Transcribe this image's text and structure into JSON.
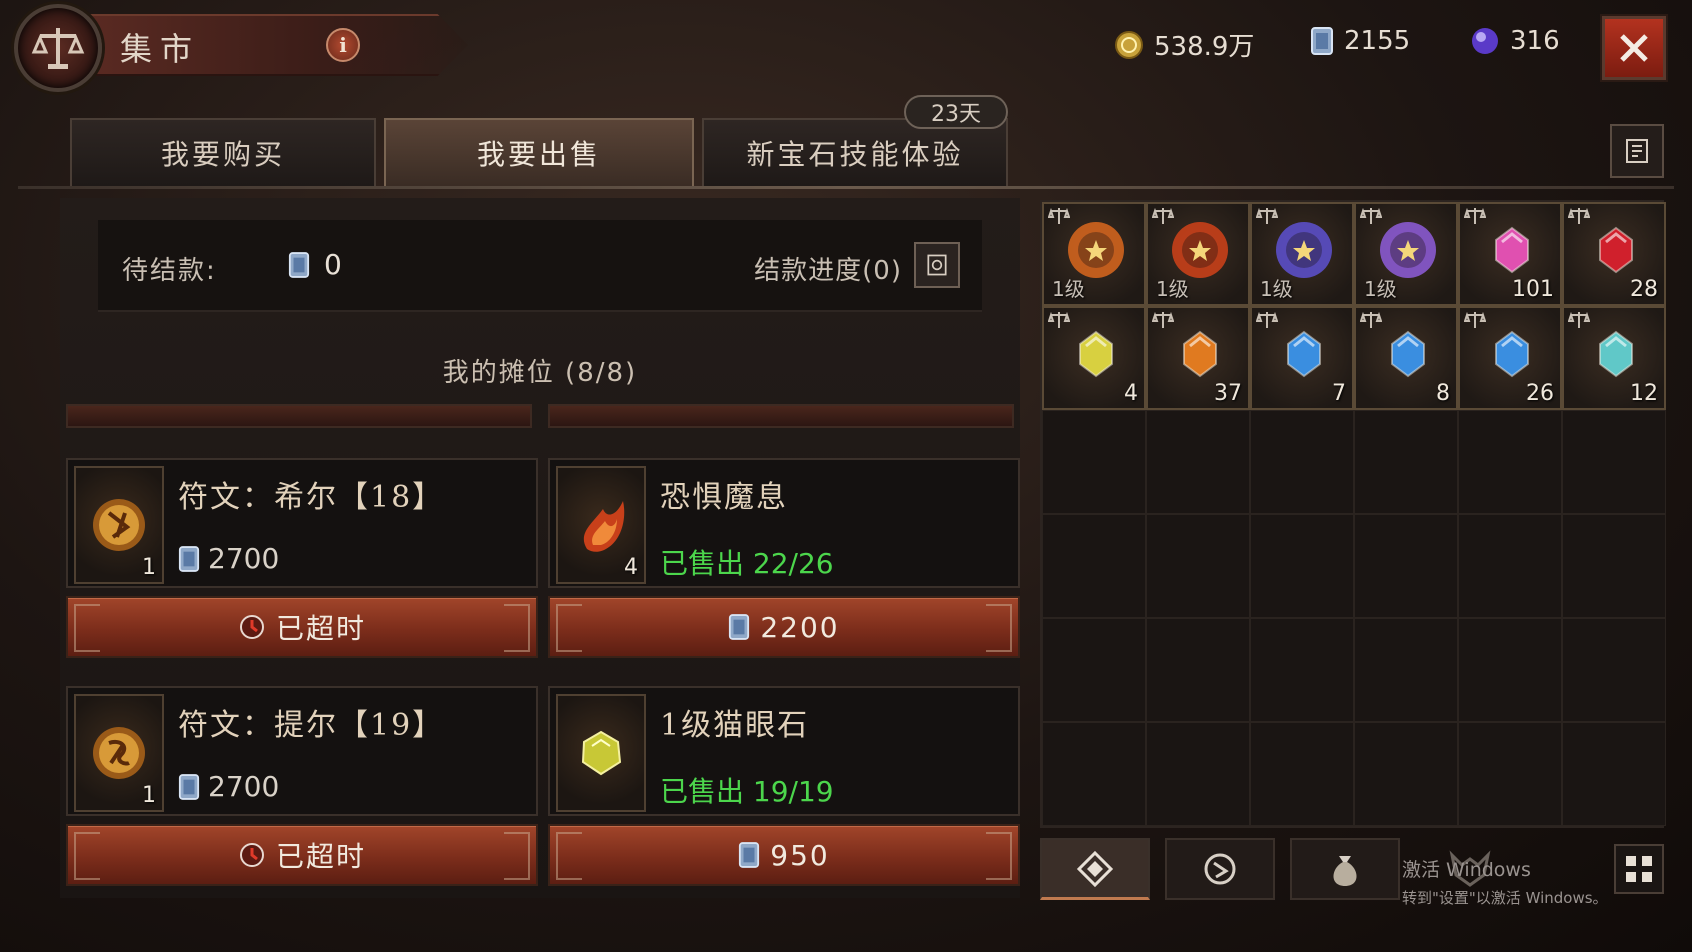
{
  "header": {
    "title": "集市",
    "info_label": "i",
    "currencies": [
      {
        "name": "gold",
        "icon": "gold-coin-icon",
        "value": "538.9万"
      },
      {
        "name": "platinum",
        "icon": "platinum-card-icon",
        "value": "2155"
      },
      {
        "name": "orb",
        "icon": "purple-orb-icon",
        "value": "316"
      }
    ]
  },
  "tabs": [
    {
      "label": "我要购买",
      "active": false
    },
    {
      "label": "我要出售",
      "active": true
    },
    {
      "label": "新宝石技能体验",
      "active": false
    }
  ],
  "days_badge": "23天",
  "settlement": {
    "pending_label": "待结款:",
    "pending_amount": "0",
    "progress_label": "结款进度(0)"
  },
  "booth": {
    "title": "我的摊位 (8/8)",
    "listings": [
      {
        "name": "符文：希尔【18】",
        "count": "1",
        "price": "2700",
        "button": "已超时",
        "icon": "rune-icon",
        "state": "expired"
      },
      {
        "name": "恐惧魔息",
        "count": "4",
        "sold": "已售出 22/26",
        "button": "2200",
        "icon": "flame-icon",
        "state": "selling"
      },
      {
        "name": "符文：提尔【19】",
        "count": "1",
        "price": "2700",
        "button": "已超时",
        "icon": "rune-icon",
        "state": "expired"
      },
      {
        "name": "1级猫眼石",
        "count": "",
        "sold": "已售出 19/19",
        "button": "950",
        "icon": "cats-eye-gem-icon",
        "state": "selling"
      }
    ]
  },
  "inventory": {
    "items": [
      {
        "icon": "legendary-gem-fire-icon",
        "level": "1级",
        "count": "",
        "color": "#d0641e"
      },
      {
        "icon": "legendary-gem-flame-icon",
        "level": "1级",
        "count": "",
        "color": "#c8401a"
      },
      {
        "icon": "legendary-gem-void-icon",
        "level": "1级",
        "count": "",
        "color": "#5b4fc8"
      },
      {
        "icon": "legendary-gem-crystal-icon",
        "level": "1级",
        "count": "",
        "color": "#8a5ad0"
      },
      {
        "icon": "pink-gem-icon",
        "level": "",
        "count": "101",
        "color": "#e050b0"
      },
      {
        "icon": "red-gem-icon",
        "level": "",
        "count": "28",
        "color": "#d0202c"
      },
      {
        "icon": "yellow-gem-icon",
        "level": "",
        "count": "4",
        "color": "#d8d040"
      },
      {
        "icon": "orange-gem-icon",
        "level": "",
        "count": "37",
        "color": "#e07a20"
      },
      {
        "icon": "blue-gem-icon",
        "level": "",
        "count": "7",
        "color": "#3a8ee0"
      },
      {
        "icon": "blue-gem-icon",
        "level": "",
        "count": "8",
        "color": "#3a8ee0"
      },
      {
        "icon": "blue-gem-icon",
        "level": "",
        "count": "26",
        "color": "#3a8ee0"
      },
      {
        "icon": "teal-gem-icon",
        "level": "",
        "count": "12",
        "color": "#60c8c8"
      }
    ]
  },
  "filters": [
    {
      "icon": "gem-filter-icon",
      "active": true
    },
    {
      "icon": "rune-filter-icon",
      "active": false
    },
    {
      "icon": "bag-filter-icon",
      "active": false
    },
    {
      "icon": "demon-filter-icon",
      "active": false
    }
  ],
  "watermark": {
    "line1": "激活 Windows",
    "line2": "转到\"设置\"以激活 Windows。"
  }
}
